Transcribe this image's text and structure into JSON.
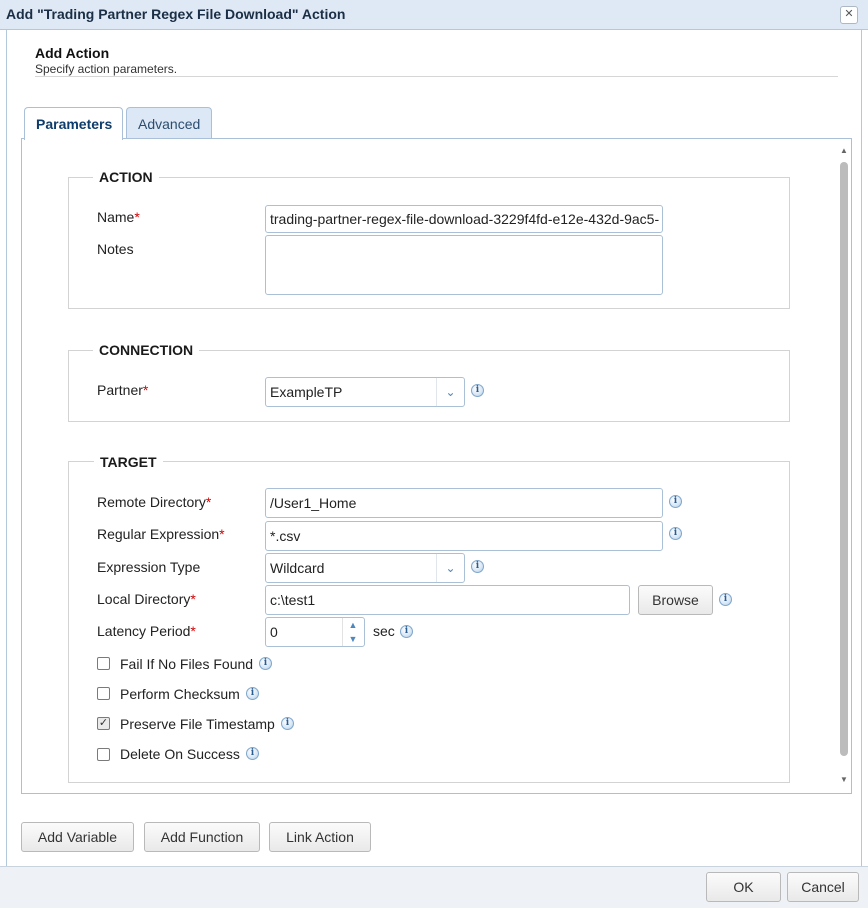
{
  "window": {
    "title": "Add \"Trading Partner Regex File Download\" Action",
    "close_glyph": "✕"
  },
  "header": {
    "title": "Add Action",
    "subtitle": "Specify action parameters."
  },
  "tabs": [
    {
      "label": "Parameters",
      "active": true
    },
    {
      "label": "Advanced",
      "active": false
    }
  ],
  "action": {
    "legend": "ACTION",
    "name_label": "Name",
    "name_value": "trading-partner-regex-file-download-3229f4fd-e12e-432d-9ac5-",
    "notes_label": "Notes",
    "notes_value": ""
  },
  "connection": {
    "legend": "CONNECTION",
    "partner_label": "Partner",
    "partner_value": "ExampleTP"
  },
  "target": {
    "legend": "TARGET",
    "remote_dir_label": "Remote Directory",
    "remote_dir_value": "/User1_Home",
    "regex_label": "Regular Expression",
    "regex_value": "*.csv",
    "expr_type_label": "Expression Type",
    "expr_type_value": "Wildcard",
    "local_dir_label": "Local Directory",
    "local_dir_value": "c:\\test1",
    "browse_label": "Browse",
    "latency_label": "Latency Period",
    "latency_value": "0",
    "latency_unit": "sec",
    "checkboxes": [
      {
        "label": "Fail If No Files Found",
        "checked": false
      },
      {
        "label": "Perform Checksum",
        "checked": false
      },
      {
        "label": "Preserve File Timestamp",
        "checked": true
      },
      {
        "label": "Delete On Success",
        "checked": false
      }
    ]
  },
  "required_marker": "*",
  "info_glyph": "i",
  "bottom_buttons": {
    "add_variable": "Add Variable",
    "add_function": "Add Function",
    "link_action": "Link Action"
  },
  "footer": {
    "ok": "OK",
    "cancel": "Cancel"
  }
}
